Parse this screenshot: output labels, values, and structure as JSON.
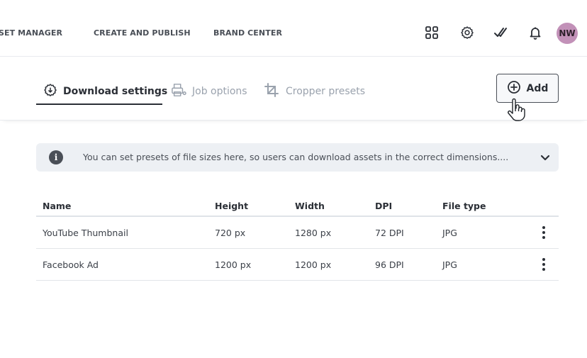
{
  "nav": {
    "items": [
      "SET MANAGER",
      "CREATE AND PUBLISH",
      "BRAND CENTER"
    ],
    "icons": [
      "apps-grid-icon",
      "settings-gear-icon",
      "check-double-icon",
      "bell-icon"
    ],
    "avatar_initials": "NW",
    "avatar_color": "#c291b8"
  },
  "tabs": [
    {
      "label": "Download settings",
      "icon": "download-settings-icon",
      "active": true
    },
    {
      "label": "Job options",
      "icon": "job-options-icon",
      "active": false
    },
    {
      "label": "Cropper presets",
      "icon": "crop-icon",
      "active": false
    }
  ],
  "add_button": {
    "label": "Add",
    "icon": "plus-circle-icon"
  },
  "banner": {
    "text": "You can set presets of file sizes here, so users can download assets in the correct dimensions....",
    "icon": "info-icon"
  },
  "table": {
    "columns": [
      "Name",
      "Height",
      "Width",
      "DPI",
      "File type"
    ],
    "rows": [
      {
        "name": "YouTube Thumbnail",
        "height": "720 px",
        "width": "1280 px",
        "dpi": "72 DPI",
        "file_type": "JPG"
      },
      {
        "name": "Facebook Ad",
        "height": "1200 px",
        "width": "1200 px",
        "dpi": "96 DPI",
        "file_type": "JPG"
      }
    ]
  }
}
